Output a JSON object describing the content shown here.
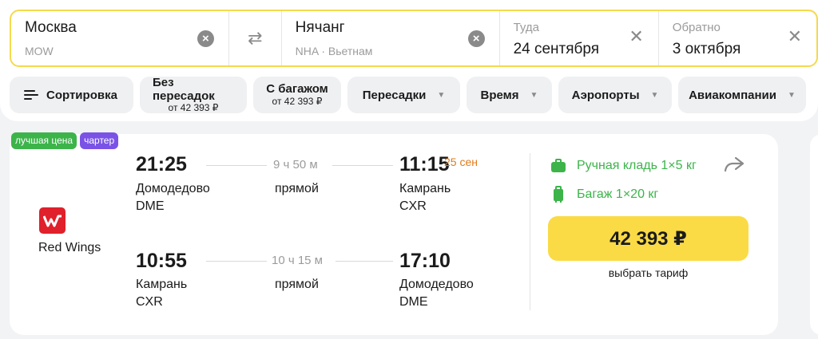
{
  "search": {
    "from_city": "Москва",
    "from_code": "MOW",
    "to_city": "Нячанг",
    "to_code": "NHA · Вьетнам",
    "depart_label": "Туда",
    "depart_date": "24 сентября",
    "return_label": "Обратно",
    "return_date": "3 октября"
  },
  "filters": {
    "sort": "Сортировка",
    "nonstop": "Без пересадок",
    "nonstop_price": "от 42 393 ₽",
    "baggage": "С багажом",
    "baggage_price": "от 42 393 ₽",
    "transfers": "Пересадки",
    "time": "Время",
    "airports": "Аэропорты",
    "airlines": "Авиакомпании"
  },
  "result": {
    "badges": {
      "best_price": "лучшая цена",
      "charter": "чартер"
    },
    "airline": "Red Wings",
    "outbound": {
      "dep_time": "21:25",
      "dep_airport": "Домодедово",
      "dep_code": "DME",
      "duration": "9 ч 50 м",
      "stops": "прямой",
      "arr_time": "11:15",
      "arr_date": "25 сен",
      "arr_airport": "Камрань",
      "arr_code": "CXR"
    },
    "return": {
      "dep_time": "10:55",
      "dep_airport": "Камрань",
      "dep_code": "CXR",
      "duration": "10 ч 15 м",
      "stops": "прямой",
      "arr_time": "17:10",
      "arr_airport": "Домодедово",
      "arr_code": "DME"
    },
    "hand_luggage": "Ручная кладь 1×5 кг",
    "baggage": "Багаж 1×20 кг",
    "price": "42 393 ₽",
    "choose_tariff": "выбрать тариф"
  },
  "colors": {
    "accent_yellow": "#fadb45",
    "search_border": "#f5d94d",
    "badge_green": "#3cb44a",
    "badge_purple": "#7a53e6",
    "airline_red": "#e0202a",
    "next_day_orange": "#e07b1a"
  }
}
